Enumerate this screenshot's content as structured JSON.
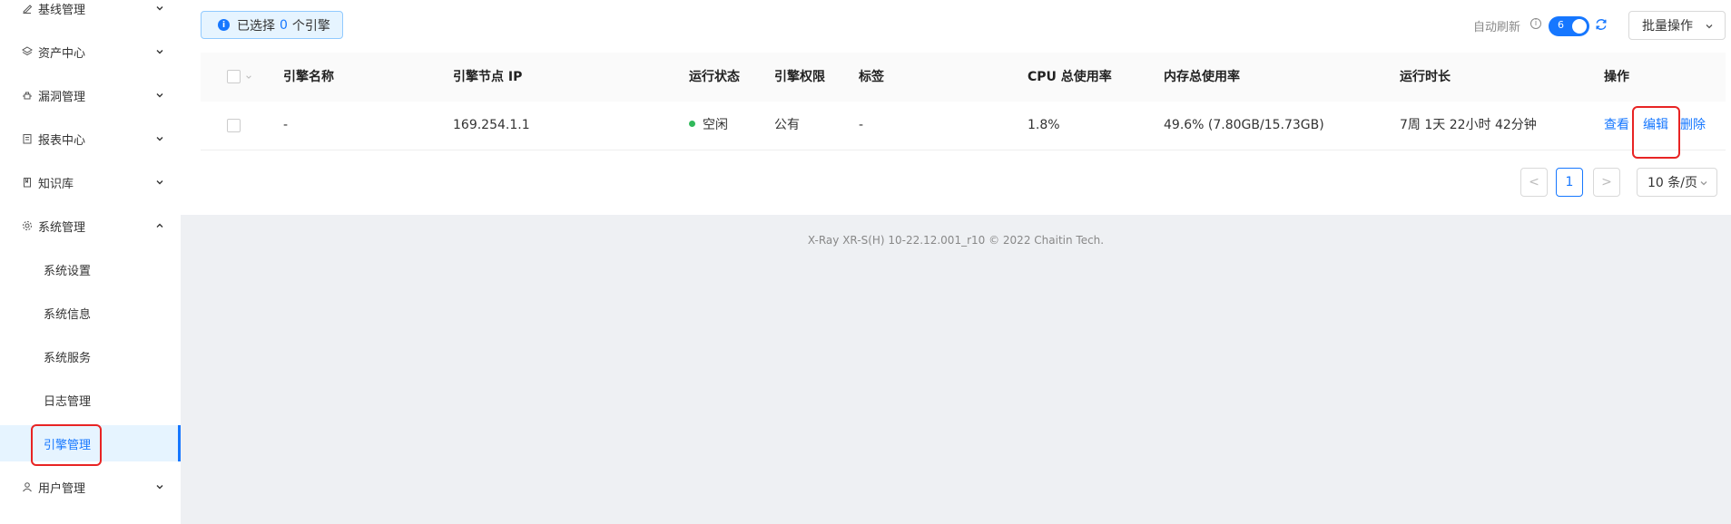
{
  "sidebar": {
    "items": [
      {
        "label": "基线管理",
        "icon": "baseline-icon"
      },
      {
        "label": "资产中心",
        "icon": "layers-icon"
      },
      {
        "label": "漏洞管理",
        "icon": "bug-icon"
      },
      {
        "label": "报表中心",
        "icon": "report-icon"
      },
      {
        "label": "知识库",
        "icon": "book-icon"
      },
      {
        "label": "系统管理",
        "icon": "gear-icon"
      },
      {
        "label": "用户管理",
        "icon": "user-icon"
      }
    ],
    "sub_items": [
      "系统设置",
      "系统信息",
      "系统服务",
      "日志管理",
      "引擎管理"
    ],
    "active_sub_item": "引擎管理"
  },
  "toolbar": {
    "selection_prefix": "已选择",
    "selection_count": "0",
    "selection_suffix": "个引擎",
    "auto_refresh_label": "自动刷新",
    "auto_refresh_value": "6",
    "batch_label": "批量操作"
  },
  "table": {
    "columns": [
      "引擎名称",
      "引擎节点 IP",
      "运行状态",
      "引擎权限",
      "标签",
      "CPU 总使用率",
      "内存总使用率",
      "运行时长",
      "操作"
    ],
    "rows": [
      {
        "name": "-",
        "ip": "169.254.1.1",
        "status": "空闲",
        "permission": "公有",
        "tag": "-",
        "cpu": "1.8%",
        "memory": "49.6% (7.80GB/15.73GB)",
        "uptime": "7周 1天 22小时 42分钟",
        "actions": [
          "查看",
          "编辑",
          "删除"
        ]
      }
    ]
  },
  "pagination": {
    "prev": "<",
    "current": "1",
    "next": ">",
    "page_size": "10 条/页"
  },
  "footer": "X-Ray XR-S(H) 10-22.12.001_r10 © 2022 Chaitin Tech.",
  "colors": {
    "accent": "#1677ff",
    "status_idle": "#31b95b",
    "highlight": "#e82424"
  }
}
